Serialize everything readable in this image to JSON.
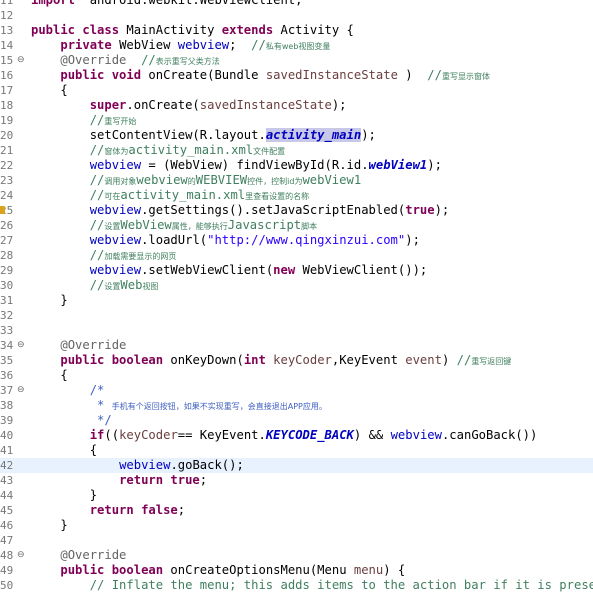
{
  "editor": {
    "lines": [
      {
        "n": "11",
        "fold": "",
        "marker": false,
        "current": false,
        "tokens": [
          [
            "kw",
            "import"
          ],
          [
            "",
            "  android.webkit.WebViewClient;"
          ]
        ]
      },
      {
        "n": "12",
        "fold": "",
        "marker": false,
        "current": false,
        "tokens": []
      },
      {
        "n": "13",
        "fold": "",
        "marker": false,
        "current": false,
        "tokens": [
          [
            "kw",
            "public class"
          ],
          [
            "",
            " MainActivity "
          ],
          [
            "kw",
            "extends"
          ],
          [
            "",
            " Activity {"
          ]
        ]
      },
      {
        "n": "14",
        "fold": "",
        "marker": false,
        "current": false,
        "tokens": [
          [
            "",
            "    "
          ],
          [
            "kw",
            "private"
          ],
          [
            "",
            " WebView "
          ],
          [
            "fld",
            "webview"
          ],
          [
            "",
            ";  "
          ],
          [
            "cm",
            "//"
          ],
          [
            "cm small",
            "私有web视图变量"
          ]
        ]
      },
      {
        "n": "15",
        "fold": "⊖",
        "marker": false,
        "current": false,
        "tokens": [
          [
            "",
            "    "
          ],
          [
            "ann",
            "@Override"
          ],
          [
            "",
            "  "
          ],
          [
            "cm",
            "//"
          ],
          [
            "cm small",
            "表示重写父类方法"
          ]
        ]
      },
      {
        "n": "16",
        "fold": "",
        "marker": false,
        "current": false,
        "tokens": [
          [
            "",
            "    "
          ],
          [
            "kw",
            "public void"
          ],
          [
            "",
            " onCreate(Bundle "
          ],
          [
            "param",
            "savedInstanceState"
          ],
          [
            "",
            " )  "
          ],
          [
            "cm",
            "//"
          ],
          [
            "cm small",
            "重写显示窗体"
          ]
        ]
      },
      {
        "n": "17",
        "fold": "",
        "marker": false,
        "current": false,
        "tokens": [
          [
            "",
            "    {"
          ]
        ]
      },
      {
        "n": "18",
        "fold": "",
        "marker": false,
        "current": false,
        "tokens": [
          [
            "",
            "        "
          ],
          [
            "kw",
            "super"
          ],
          [
            "",
            ".onCreate("
          ],
          [
            "param",
            "savedInstanceState"
          ],
          [
            "",
            ");"
          ]
        ]
      },
      {
        "n": "19",
        "fold": "",
        "marker": false,
        "current": false,
        "tokens": [
          [
            "",
            "        "
          ],
          [
            "cm",
            "//"
          ],
          [
            "cm small",
            "重写开始"
          ]
        ]
      },
      {
        "n": "20",
        "fold": "",
        "marker": false,
        "current": false,
        "tokens": [
          [
            "",
            "        setContentView(R.layout."
          ],
          [
            "fldi occ",
            "activity_main"
          ],
          [
            "",
            ");"
          ]
        ]
      },
      {
        "n": "21",
        "fold": "",
        "marker": false,
        "current": false,
        "tokens": [
          [
            "",
            "        "
          ],
          [
            "cm",
            "//"
          ],
          [
            "cm small",
            "窗体为"
          ],
          [
            "cm",
            "activity_main.xml"
          ],
          [
            "cm small",
            "文件配置"
          ]
        ]
      },
      {
        "n": "22",
        "fold": "",
        "marker": false,
        "current": false,
        "tokens": [
          [
            "",
            "        "
          ],
          [
            "fld",
            "webview"
          ],
          [
            "",
            " = (WebView) findViewById(R.id."
          ],
          [
            "fldi",
            "webView1"
          ],
          [
            "",
            ");"
          ]
        ]
      },
      {
        "n": "23",
        "fold": "",
        "marker": false,
        "current": false,
        "tokens": [
          [
            "",
            "        "
          ],
          [
            "cm",
            "//"
          ],
          [
            "cm small",
            "调用对象"
          ],
          [
            "cm",
            "webview"
          ],
          [
            "cm small",
            "的"
          ],
          [
            "cm",
            "WEBVIEW"
          ],
          [
            "cm small",
            "控件，控制id为"
          ],
          [
            "cm",
            "webView1"
          ]
        ]
      },
      {
        "n": "24",
        "fold": "",
        "marker": false,
        "current": false,
        "tokens": [
          [
            "",
            "        "
          ],
          [
            "cm",
            "//"
          ],
          [
            "cm small",
            "可在"
          ],
          [
            "cm",
            "activity_main.xml"
          ],
          [
            "cm small",
            "里查看设置的名称"
          ]
        ]
      },
      {
        "n": "25",
        "fold": "",
        "marker": true,
        "current": false,
        "tokens": [
          [
            "",
            "        "
          ],
          [
            "fld",
            "webview"
          ],
          [
            "",
            ".getSettings().setJavaScriptEnabled("
          ],
          [
            "kw",
            "true"
          ],
          [
            "",
            ");"
          ]
        ]
      },
      {
        "n": "26",
        "fold": "",
        "marker": false,
        "current": false,
        "tokens": [
          [
            "",
            "        "
          ],
          [
            "cm",
            "//"
          ],
          [
            "cm small",
            "设置"
          ],
          [
            "cm",
            "WebView"
          ],
          [
            "cm small",
            "属性，能够执行"
          ],
          [
            "cm",
            "Javascript"
          ],
          [
            "cm small",
            "脚本"
          ]
        ]
      },
      {
        "n": "27",
        "fold": "",
        "marker": false,
        "current": false,
        "tokens": [
          [
            "",
            "        "
          ],
          [
            "fld",
            "webview"
          ],
          [
            "",
            ".loadUrl("
          ],
          [
            "str",
            "\"http://www.qingxinzui.com\""
          ],
          [
            "",
            ");"
          ]
        ]
      },
      {
        "n": "28",
        "fold": "",
        "marker": false,
        "current": false,
        "tokens": [
          [
            "",
            "        "
          ],
          [
            "cm",
            "//"
          ],
          [
            "cm small",
            "加载需要显示的网页"
          ]
        ]
      },
      {
        "n": "29",
        "fold": "",
        "marker": false,
        "current": false,
        "tokens": [
          [
            "",
            "        "
          ],
          [
            "fld",
            "webview"
          ],
          [
            "",
            ".setWebViewClient("
          ],
          [
            "kw",
            "new"
          ],
          [
            "",
            " WebViewClient());"
          ]
        ]
      },
      {
        "n": "30",
        "fold": "",
        "marker": false,
        "current": false,
        "tokens": [
          [
            "",
            "        "
          ],
          [
            "cm",
            "//"
          ],
          [
            "cm small",
            "设置"
          ],
          [
            "cm",
            "Web"
          ],
          [
            "cm small",
            "视图"
          ]
        ]
      },
      {
        "n": "31",
        "fold": "",
        "marker": false,
        "current": false,
        "tokens": [
          [
            "",
            "    }"
          ]
        ]
      },
      {
        "n": "32",
        "fold": "",
        "marker": false,
        "current": false,
        "tokens": []
      },
      {
        "n": "33",
        "fold": "",
        "marker": false,
        "current": false,
        "tokens": []
      },
      {
        "n": "34",
        "fold": "⊖",
        "marker": false,
        "current": false,
        "tokens": [
          [
            "",
            "    "
          ],
          [
            "ann",
            "@Override"
          ]
        ]
      },
      {
        "n": "35",
        "fold": "",
        "marker": false,
        "current": false,
        "tokens": [
          [
            "",
            "    "
          ],
          [
            "kw",
            "public boolean"
          ],
          [
            "",
            " onKeyDown("
          ],
          [
            "kw",
            "int"
          ],
          [
            "",
            " "
          ],
          [
            "param",
            "keyCoder"
          ],
          [
            "",
            ",KeyEvent "
          ],
          [
            "param",
            "event"
          ],
          [
            "",
            ") "
          ],
          [
            "cm",
            "//"
          ],
          [
            "cm small",
            "重写返回键"
          ]
        ]
      },
      {
        "n": "36",
        "fold": "",
        "marker": false,
        "current": false,
        "tokens": [
          [
            "",
            "    {"
          ]
        ]
      },
      {
        "n": "37",
        "fold": "⊖",
        "marker": false,
        "current": false,
        "tokens": [
          [
            "",
            "        "
          ],
          [
            "jd",
            "/*"
          ]
        ]
      },
      {
        "n": "38",
        "fold": "",
        "marker": false,
        "current": false,
        "tokens": [
          [
            "",
            "         "
          ],
          [
            "jd",
            "* "
          ],
          [
            "jd small",
            "手机有个返回按钮，如果不实现重写，会直接退出APP应用。"
          ]
        ]
      },
      {
        "n": "39",
        "fold": "",
        "marker": false,
        "current": false,
        "tokens": [
          [
            "",
            "         "
          ],
          [
            "jd",
            "*/"
          ]
        ]
      },
      {
        "n": "40",
        "fold": "",
        "marker": false,
        "current": false,
        "tokens": [
          [
            "",
            "        "
          ],
          [
            "kw",
            "if"
          ],
          [
            "",
            "(("
          ],
          [
            "param",
            "keyCoder"
          ],
          [
            "",
            "== KeyEvent."
          ],
          [
            "fldi",
            "KEYCODE_BACK"
          ],
          [
            "",
            ") && "
          ],
          [
            "fld",
            "webview"
          ],
          [
            "",
            ".canGoBack())"
          ]
        ]
      },
      {
        "n": "41",
        "fold": "",
        "marker": false,
        "current": false,
        "tokens": [
          [
            "",
            "        {"
          ]
        ]
      },
      {
        "n": "42",
        "fold": "",
        "marker": false,
        "current": true,
        "tokens": [
          [
            "",
            "            "
          ],
          [
            "fld",
            "webview"
          ],
          [
            "",
            ".goBack();"
          ]
        ]
      },
      {
        "n": "43",
        "fold": "",
        "marker": false,
        "current": false,
        "tokens": [
          [
            "",
            "            "
          ],
          [
            "kw",
            "return true"
          ],
          [
            "",
            ";"
          ]
        ]
      },
      {
        "n": "44",
        "fold": "",
        "marker": false,
        "current": false,
        "tokens": [
          [
            "",
            "        }"
          ]
        ]
      },
      {
        "n": "45",
        "fold": "",
        "marker": false,
        "current": false,
        "tokens": [
          [
            "",
            "        "
          ],
          [
            "kw",
            "return false"
          ],
          [
            "",
            ";"
          ]
        ]
      },
      {
        "n": "46",
        "fold": "",
        "marker": false,
        "current": false,
        "tokens": [
          [
            "",
            "    }"
          ]
        ]
      },
      {
        "n": "47",
        "fold": "",
        "marker": false,
        "current": false,
        "tokens": []
      },
      {
        "n": "48",
        "fold": "⊖",
        "marker": false,
        "current": false,
        "tokens": [
          [
            "",
            "    "
          ],
          [
            "ann",
            "@Override"
          ]
        ]
      },
      {
        "n": "49",
        "fold": "",
        "marker": false,
        "current": false,
        "tokens": [
          [
            "",
            "    "
          ],
          [
            "kw",
            "public boolean"
          ],
          [
            "",
            " onCreateOptionsMenu(Menu "
          ],
          [
            "param",
            "menu"
          ],
          [
            "",
            ") {"
          ]
        ]
      },
      {
        "n": "50",
        "fold": "",
        "marker": false,
        "current": false,
        "tokens": [
          [
            "",
            "        "
          ],
          [
            "cm",
            "// Inflate the menu; this adds items to the action bar if it is present."
          ]
        ]
      }
    ]
  },
  "colors": {
    "keyword": "#7f0055",
    "field": "#0000c0",
    "string": "#2a00ff",
    "comment": "#3f7f5f",
    "javadoc": "#3f5fbf",
    "annotation": "#646464",
    "parameter": "#6a3e3e",
    "current_line": "#e8f2fe",
    "occurrence": "#c8c8e8",
    "warning_marker": "#d9a41b"
  }
}
